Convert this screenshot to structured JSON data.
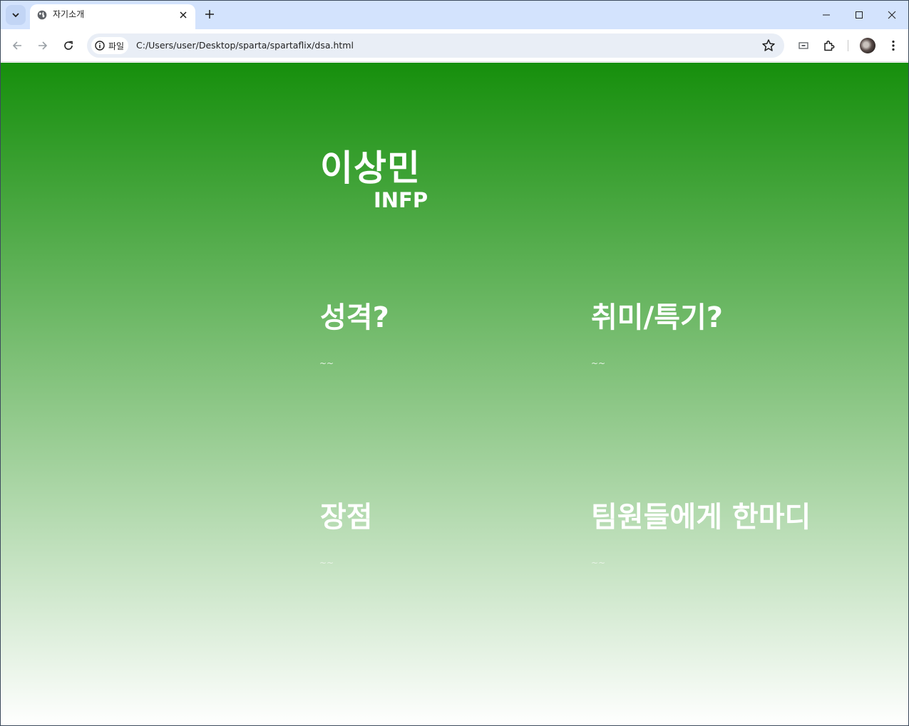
{
  "browser": {
    "tab_title": "자기소개",
    "site_chip_label": "파일",
    "url": "C:/Users/user/Desktop/sparta/spartaflix/dsa.html"
  },
  "page": {
    "name": "이상민",
    "mbti": "INFP",
    "sections": [
      {
        "title": "성격?",
        "body": "~~"
      },
      {
        "title": "취미/특기?",
        "body": "~~"
      },
      {
        "title": "장점",
        "body": "~~"
      },
      {
        "title": "팀원들에게 한마디",
        "body": "~~"
      }
    ]
  },
  "colors": {
    "gradient_top": "#168f0c",
    "gradient_bottom": "#ffffff",
    "tabstrip": "#d3e3fd"
  }
}
